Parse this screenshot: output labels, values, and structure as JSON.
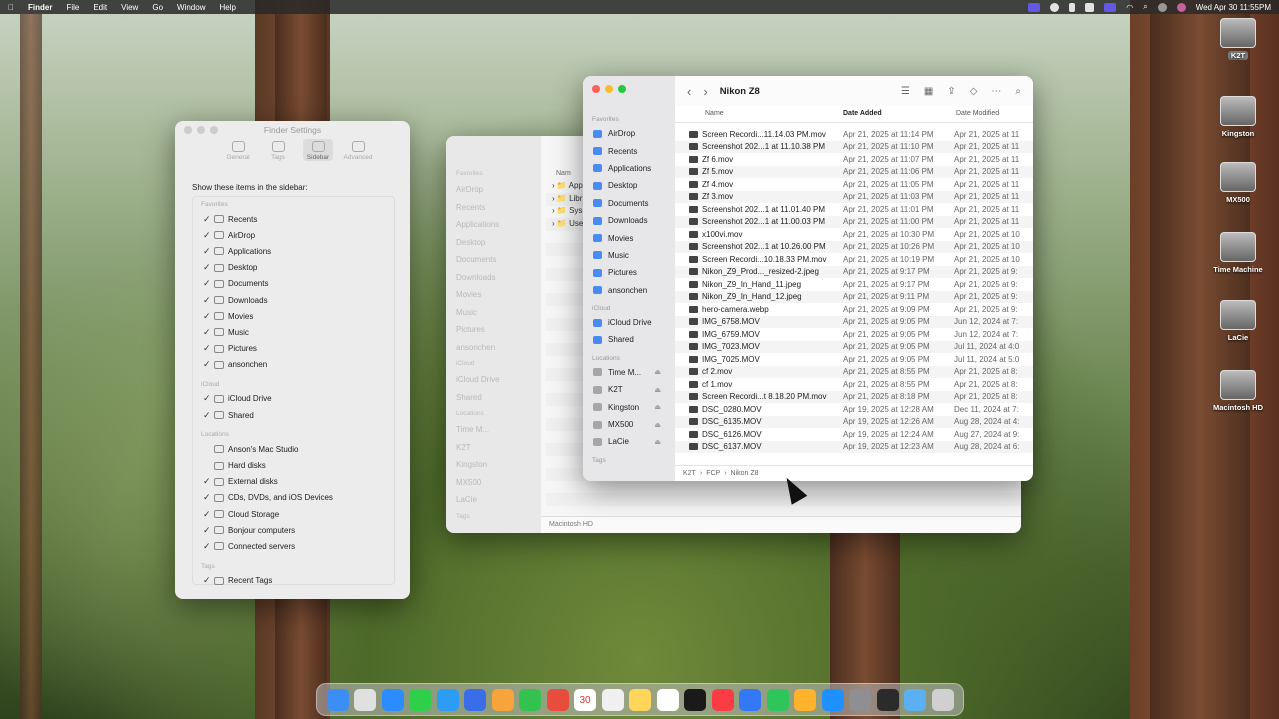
{
  "menubar": {
    "apple": "",
    "app": "Finder",
    "items": [
      "File",
      "Edit",
      "View",
      "Go",
      "Window",
      "Help"
    ],
    "clock": "Wed Apr 30  11:55PM"
  },
  "settings": {
    "title": "Finder Settings",
    "tabs": [
      "General",
      "Tags",
      "Sidebar",
      "Advanced"
    ],
    "selected_tab": "Sidebar",
    "header": "Show these items in the sidebar:",
    "groups": [
      {
        "name": "Favorites",
        "items": [
          {
            "label": "Recents",
            "checked": true
          },
          {
            "label": "AirDrop",
            "checked": true
          },
          {
            "label": "Applications",
            "checked": true
          },
          {
            "label": "Desktop",
            "checked": true
          },
          {
            "label": "Documents",
            "checked": true
          },
          {
            "label": "Downloads",
            "checked": true
          },
          {
            "label": "Movies",
            "checked": true
          },
          {
            "label": "Music",
            "checked": true
          },
          {
            "label": "Pictures",
            "checked": true
          },
          {
            "label": "ansonchen",
            "checked": true
          }
        ]
      },
      {
        "name": "iCloud",
        "items": [
          {
            "label": "iCloud Drive",
            "checked": true
          },
          {
            "label": "Shared",
            "checked": true
          }
        ]
      },
      {
        "name": "Locations",
        "items": [
          {
            "label": "Anson's Mac Studio",
            "checked": false
          },
          {
            "label": "Hard disks",
            "checked": false
          },
          {
            "label": "External disks",
            "checked": true
          },
          {
            "label": "CDs, DVDs, and iOS Devices",
            "checked": true
          },
          {
            "label": "Cloud Storage",
            "checked": true
          },
          {
            "label": "Bonjour computers",
            "checked": true
          },
          {
            "label": "Connected servers",
            "checked": true
          }
        ]
      },
      {
        "name": "Tags",
        "items": [
          {
            "label": "Recent Tags",
            "checked": true
          }
        ]
      }
    ]
  },
  "back_window": {
    "sidebar": {
      "favorites_label": "Favorites",
      "favorites": [
        "AirDrop",
        "Recents",
        "Applications",
        "Desktop",
        "Documents",
        "Downloads",
        "Movies",
        "Music",
        "Pictures",
        "ansonchen"
      ],
      "icloud_label": "iCloud",
      "icloud": [
        "iCloud Drive",
        "Shared"
      ],
      "locations_label": "Locations",
      "locations": [
        "Time M...",
        "K2T",
        "Kingston",
        "MX500",
        "LaCie"
      ],
      "tags_label": "Tags"
    },
    "header": "Nam",
    "items": [
      "App",
      "Libr",
      "Sys",
      "Use"
    ],
    "footer": "Macintosh HD"
  },
  "front_window": {
    "title": "Nikon Z8",
    "sidebar": {
      "favorites_label": "Favorites",
      "favorites": [
        "AirDrop",
        "Recents",
        "Applications",
        "Desktop",
        "Documents",
        "Downloads",
        "Movies",
        "Music",
        "Pictures",
        "ansonchen"
      ],
      "icloud_label": "iCloud",
      "icloud": [
        "iCloud Drive",
        "Shared"
      ],
      "locations_label": "Locations",
      "locations": [
        "Time M...",
        "K2T",
        "Kingston",
        "MX500",
        "LaCie"
      ],
      "tags_label": "Tags"
    },
    "columns": {
      "name": "Name",
      "added": "Date Added",
      "modified": "Date Modified"
    },
    "files": [
      {
        "name": "Screen Recordi...11.14.03 PM.mov",
        "added": "Apr 21, 2025 at 11:14 PM",
        "modified": "Apr 21, 2025 at 11"
      },
      {
        "name": "Screenshot 202...1 at 11.10.38 PM",
        "added": "Apr 21, 2025 at 11:10 PM",
        "modified": "Apr 21, 2025 at 11"
      },
      {
        "name": "Zf 6.mov",
        "added": "Apr 21, 2025 at 11:07 PM",
        "modified": "Apr 21, 2025 at 11"
      },
      {
        "name": "Zf 5.mov",
        "added": "Apr 21, 2025 at 11:06 PM",
        "modified": "Apr 21, 2025 at 11"
      },
      {
        "name": "Zf 4.mov",
        "added": "Apr 21, 2025 at 11:05 PM",
        "modified": "Apr 21, 2025 at 11"
      },
      {
        "name": "Zf 3.mov",
        "added": "Apr 21, 2025 at 11:03 PM",
        "modified": "Apr 21, 2025 at 11"
      },
      {
        "name": "Screenshot 202...1 at 11.01.40 PM",
        "added": "Apr 21, 2025 at 11:01 PM",
        "modified": "Apr 21, 2025 at 11"
      },
      {
        "name": "Screenshot 202...1 at 11.00.03 PM",
        "added": "Apr 21, 2025 at 11:00 PM",
        "modified": "Apr 21, 2025 at 11"
      },
      {
        "name": "x100vi.mov",
        "added": "Apr 21, 2025 at 10:30 PM",
        "modified": "Apr 21, 2025 at 10"
      },
      {
        "name": "Screenshot 202...1 at 10.26.00 PM",
        "added": "Apr 21, 2025 at 10:26 PM",
        "modified": "Apr 21, 2025 at 10"
      },
      {
        "name": "Screen Recordi...10.18.33 PM.mov",
        "added": "Apr 21, 2025 at 10:19 PM",
        "modified": "Apr 21, 2025 at 10"
      },
      {
        "name": "Nikon_Z9_Prod..._resized-2.jpeg",
        "added": "Apr 21, 2025 at 9:17 PM",
        "modified": "Apr 21, 2025 at 9:"
      },
      {
        "name": "Nikon_Z9_In_Hand_11.jpeg",
        "added": "Apr 21, 2025 at 9:17 PM",
        "modified": "Apr 21, 2025 at 9:"
      },
      {
        "name": "Nikon_Z9_In_Hand_12.jpeg",
        "added": "Apr 21, 2025 at 9:11 PM",
        "modified": "Apr 21, 2025 at 9:"
      },
      {
        "name": "hero-camera.webp",
        "added": "Apr 21, 2025 at 9:09 PM",
        "modified": "Apr 21, 2025 at 9:"
      },
      {
        "name": "IMG_6758.MOV",
        "added": "Apr 21, 2025 at 9:05 PM",
        "modified": "Jun 12, 2024 at 7:"
      },
      {
        "name": "IMG_6759.MOV",
        "added": "Apr 21, 2025 at 9:05 PM",
        "modified": "Jun 12, 2024 at 7:"
      },
      {
        "name": "IMG_7023.MOV",
        "added": "Apr 21, 2025 at 9:05 PM",
        "modified": "Jul 11, 2024 at 4:0"
      },
      {
        "name": "IMG_7025.MOV",
        "added": "Apr 21, 2025 at 9:05 PM",
        "modified": "Jul 11, 2024 at 5:0"
      },
      {
        "name": "cf 2.mov",
        "added": "Apr 21, 2025 at 8:55 PM",
        "modified": "Apr 21, 2025 at 8:"
      },
      {
        "name": "cf 1.mov",
        "added": "Apr 21, 2025 at 8:55 PM",
        "modified": "Apr 21, 2025 at 8:"
      },
      {
        "name": "Screen Recordi...t 8.18.20 PM.mov",
        "added": "Apr 21, 2025 at 8:18 PM",
        "modified": "Apr 21, 2025 at 8:"
      },
      {
        "name": "DSC_0280.MOV",
        "added": "Apr 19, 2025 at 12:28 AM",
        "modified": "Dec 11, 2024 at 7:"
      },
      {
        "name": "DSC_6135.MOV",
        "added": "Apr 19, 2025 at 12:26 AM",
        "modified": "Aug 28, 2024 at 4:"
      },
      {
        "name": "DSC_6126.MOV",
        "added": "Apr 19, 2025 at 12:24 AM",
        "modified": "Aug 27, 2024 at 9:"
      },
      {
        "name": "DSC_6137.MOV",
        "added": "Apr 19, 2025 at 12:23 AM",
        "modified": "Aug 28, 2024 at 6:"
      }
    ],
    "path": [
      "K2T",
      "FCP",
      "Nikon Z8"
    ]
  },
  "desktop_icons": [
    "K2T",
    "Kingston",
    "MX500",
    "Time Machine",
    "LaCie",
    "Macintosh HD"
  ],
  "dock": {
    "calendar_day": "30",
    "colors": [
      "#3b8ef5",
      "#e0e0e0",
      "#2a8cff",
      "#2fcf4a",
      "#2d9cf5",
      "#3a6ee8",
      "#f7a43a",
      "#33c24d",
      "#e74c3c",
      "#b9893c",
      "#f0f0f0",
      "#ffd65a",
      "#ffffff",
      "#1a1a1a",
      "#fc3c44",
      "#3478f6",
      "#2ec55a",
      "#ffb32c",
      "#1e90ff",
      "#8e8e93",
      "#2b2b2b",
      "#5ab0f0",
      "#d0d0d0"
    ]
  }
}
